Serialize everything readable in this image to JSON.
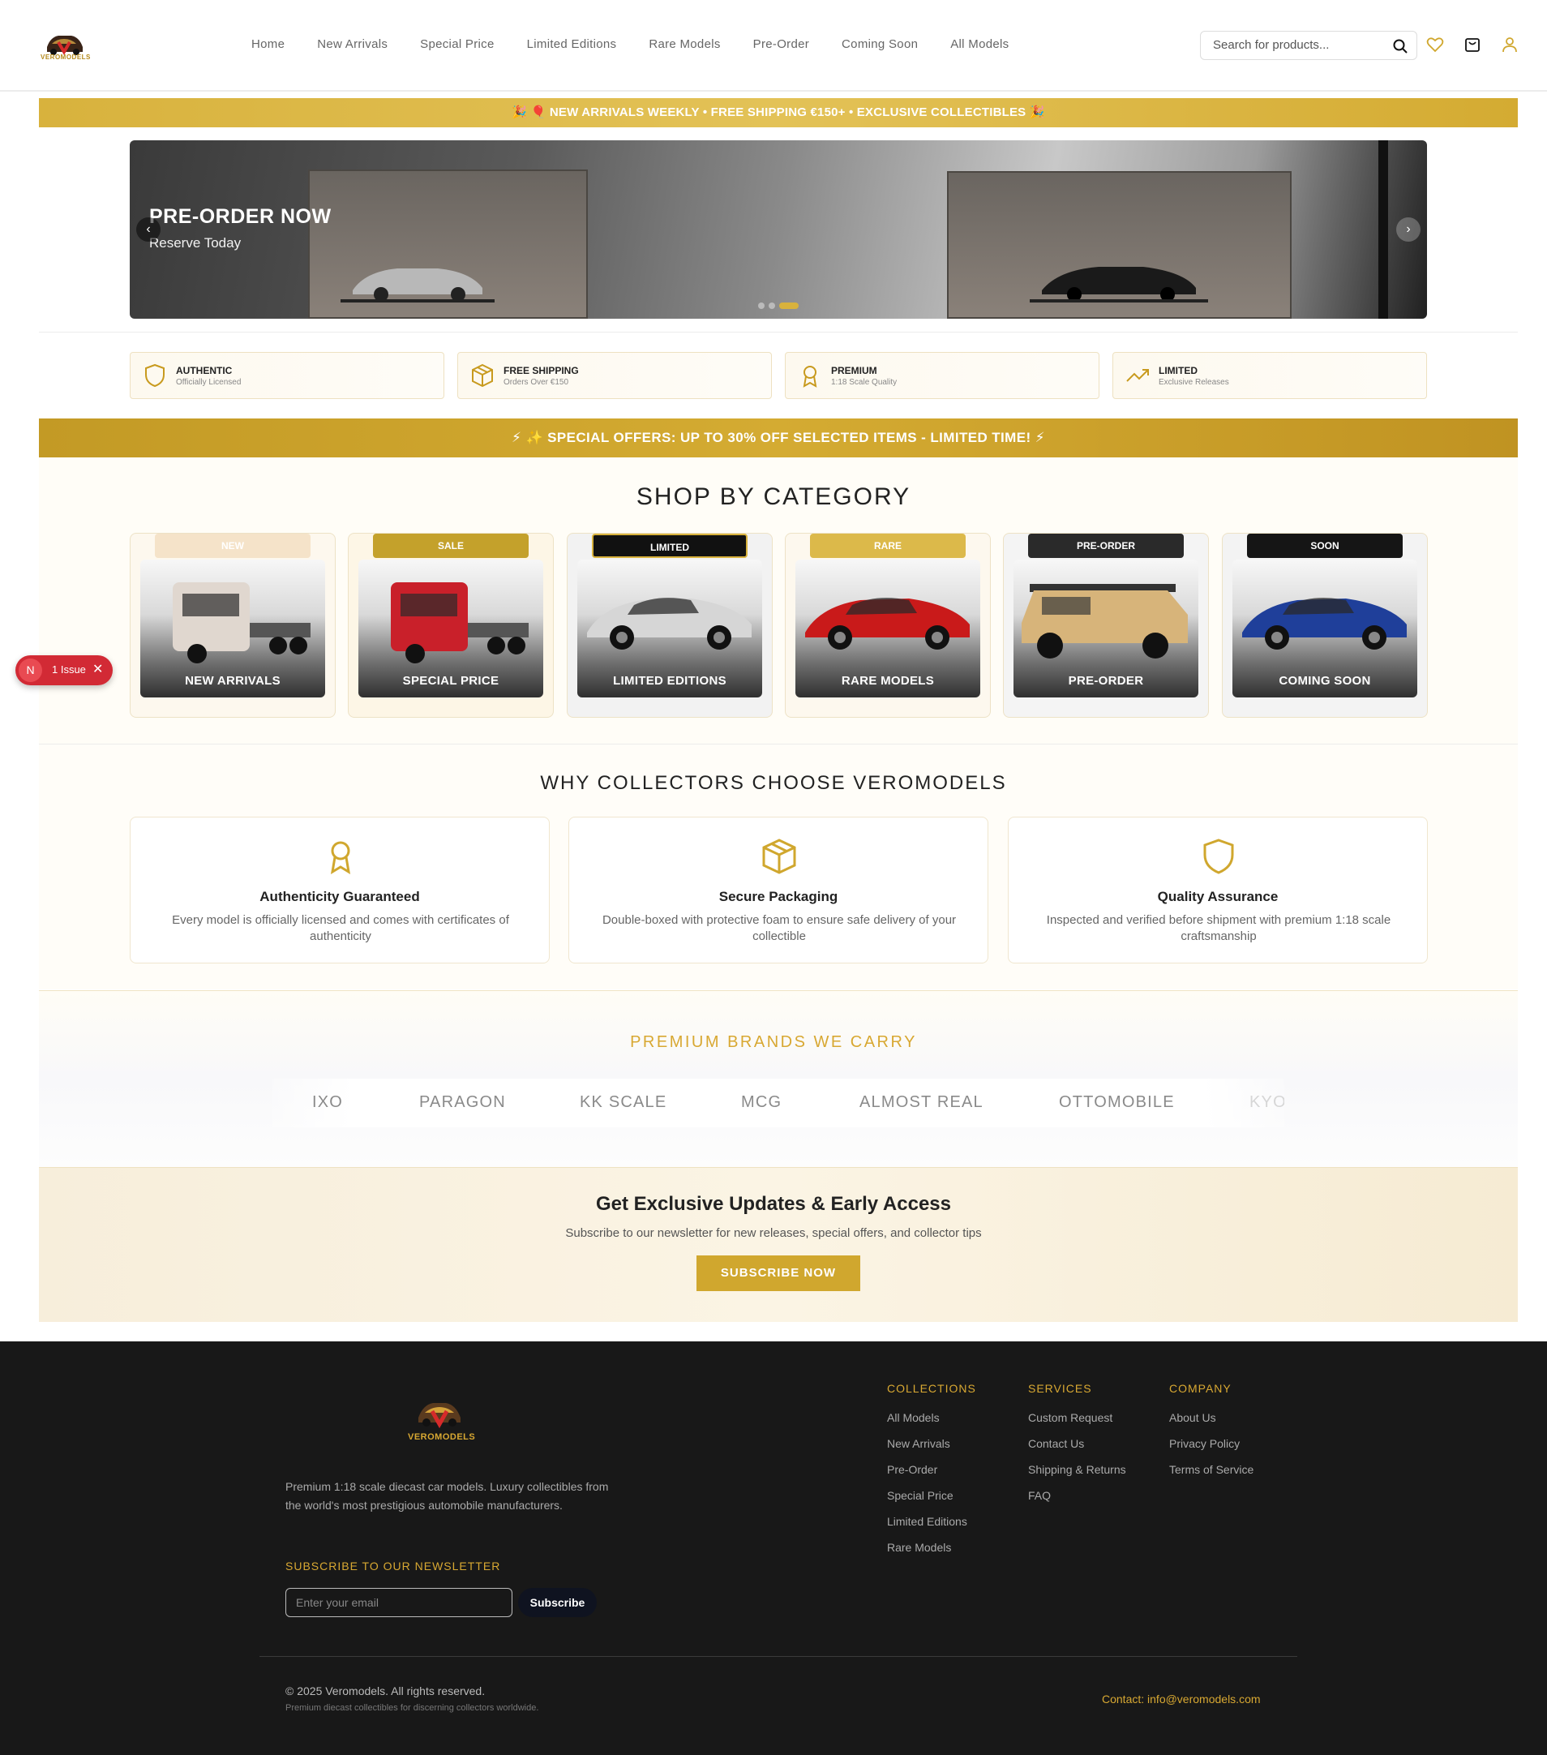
{
  "header": {
    "logo_text": "VEROMODELS",
    "nav": [
      "Home",
      "New Arrivals",
      "Special Price",
      "Limited Editions",
      "Rare Models",
      "Pre-Order",
      "Coming Soon",
      "All Models"
    ],
    "search_placeholder": "Search for products..."
  },
  "top_banner": "🎉 🎈 NEW ARRIVALS WEEKLY • FREE SHIPPING €150+ • EXCLUSIVE COLLECTIBLES 🎉",
  "hero": {
    "title": "PRE-ORDER NOW",
    "subtitle": "Reserve Today",
    "prev": "‹",
    "next": "›",
    "slide_count": 3,
    "active_slide": 3
  },
  "features": [
    {
      "title": "AUTHENTIC",
      "sub": "Officially Licensed",
      "icon": "shield-icon"
    },
    {
      "title": "FREE SHIPPING",
      "sub": "Orders Over €150",
      "icon": "package-icon"
    },
    {
      "title": "PREMIUM",
      "sub": "1:18 Scale Quality",
      "icon": "award-icon"
    },
    {
      "title": "LIMITED",
      "sub": "Exclusive Releases",
      "icon": "trending-up-icon"
    }
  ],
  "offer_banner": "⚡ ✨ SPECIAL OFFERS: UP TO 30% OFF SELECTED ITEMS - LIMITED TIME! ⚡",
  "categories": {
    "title": "SHOP BY CATEGORY",
    "items": [
      {
        "badge": "NEW",
        "label": "NEW ARRIVALS",
        "badge_color": "#f5e3c9",
        "vehicle": "truck-white",
        "accent": "#e0d7cf"
      },
      {
        "badge": "SALE",
        "label": "SPECIAL PRICE",
        "badge_color": "#c4a12b",
        "vehicle": "truck-red",
        "accent": "#c9202a"
      },
      {
        "badge": "LIMITED",
        "label": "LIMITED EDITIONS",
        "badge_color": "#111111",
        "vehicle": "car-silver",
        "accent": "#d6d6d6"
      },
      {
        "badge": "RARE",
        "label": "RARE MODELS",
        "badge_color": "#dcb94a",
        "vehicle": "car-red",
        "accent": "#c91a1a"
      },
      {
        "badge": "PRE-ORDER",
        "label": "PRE-ORDER",
        "badge_color": "#2a2a2a",
        "vehicle": "suv-tan",
        "accent": "#d7b47a"
      },
      {
        "badge": "SOON",
        "label": "COMING SOON",
        "badge_color": "#151515",
        "vehicle": "car-blue",
        "accent": "#1f3f9a"
      }
    ]
  },
  "issue_badge": {
    "letter": "N",
    "text": "1 Issue",
    "close": "✕"
  },
  "why": {
    "title": "WHY COLLECTORS CHOOSE VEROMODELS",
    "items": [
      {
        "title": "Authenticity Guaranteed",
        "desc": "Every model is officially licensed and comes with certificates of authenticity",
        "icon": "award-icon"
      },
      {
        "title": "Secure Packaging",
        "desc": "Double-boxed with protective foam to ensure safe delivery of your collectible",
        "icon": "package-icon"
      },
      {
        "title": "Quality Assurance",
        "desc": "Inspected and verified before shipment with premium 1:18 scale craftsmanship",
        "icon": "shield-icon"
      }
    ]
  },
  "brands": {
    "title": "PREMIUM BRANDS WE CARRY",
    "items": [
      "IXO",
      "PARAGON",
      "KK SCALE",
      "MCG",
      "ALMOST REAL",
      "OTTOMOBILE",
      "KYO"
    ]
  },
  "newsletter": {
    "title": "Get Exclusive Updates & Early Access",
    "subtitle": "Subscribe to our newsletter for new releases, special offers, and collector tips",
    "button": "SUBSCRIBE NOW"
  },
  "footer": {
    "logo_text": "VEROMODELS",
    "description": "Premium 1:18 scale diecast car models. Luxury collectibles from the world's most prestigious automobile manufacturers.",
    "newsletter_title": "SUBSCRIBE TO OUR NEWSLETTER",
    "email_placeholder": "Enter your email",
    "subscribe_button": "Subscribe",
    "columns": [
      {
        "title": "COLLECTIONS",
        "links": [
          "All Models",
          "New Arrivals",
          "Pre-Order",
          "Special Price",
          "Limited Editions",
          "Rare Models"
        ]
      },
      {
        "title": "SERVICES",
        "links": [
          "Custom Request",
          "Contact Us",
          "Shipping & Returns",
          "FAQ"
        ]
      },
      {
        "title": "COMPANY",
        "links": [
          "About Us",
          "Privacy Policy",
          "Terms of Service"
        ]
      }
    ],
    "copyright": "© 2025 Veromodels. All rights reserved.",
    "tagline": "Premium diecast collectibles for discerning collectors worldwide.",
    "contact": "Contact: info@veromodels.com"
  },
  "colors": {
    "gold": "#d8b23d",
    "dark": "#181818"
  }
}
